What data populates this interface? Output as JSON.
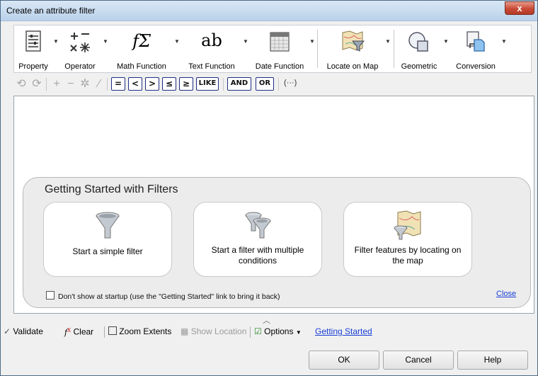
{
  "window": {
    "title": "Create an attribute filter",
    "close_glyph": "x"
  },
  "ribbon": {
    "items": [
      {
        "label": "Property",
        "icon": "property-list-icon"
      },
      {
        "label": "Operator",
        "icon": "operator-icon"
      },
      {
        "label": "Math Function",
        "icon": "math-function-icon",
        "glyph": "fΣ"
      },
      {
        "label": "Text Function",
        "icon": "text-function-icon",
        "glyph": "ab"
      },
      {
        "label": "Date Function",
        "icon": "calendar-icon"
      },
      {
        "label": "Locate on Map",
        "icon": "map-filter-icon"
      },
      {
        "label": "Geometric",
        "icon": "geometric-icon"
      },
      {
        "label": "Conversion",
        "icon": "conversion-icon"
      }
    ]
  },
  "operators": {
    "eq": "=",
    "lt": "<",
    "gt": ">",
    "le": "≤",
    "ge": "≥",
    "like": "LIKE",
    "and": "AND",
    "or": "OR",
    "paren": "(···)"
  },
  "getting_started": {
    "title": "Getting Started with Filters",
    "cards": [
      {
        "text": "Start a simple filter",
        "icon": "funnel-icon"
      },
      {
        "text": "Start a filter with multiple conditions",
        "icon": "multiple-funnels-icon"
      },
      {
        "text": "Filter features by locating on the map",
        "icon": "map-funnel-icon"
      }
    ],
    "checkbox_label": "Don't show at startup (use the \"Getting Started\" link to bring it back)",
    "close_link": "Close"
  },
  "statusbar": {
    "validate": "Validate",
    "clear": "Clear",
    "zoom_extents": "Zoom Extents",
    "show_location": "Show Location",
    "options": "Options",
    "getting_started": "Getting Started"
  },
  "buttons": {
    "ok": "OK",
    "cancel": "Cancel",
    "help": "Help"
  },
  "colors": {
    "accent_link": "#1a3fd6",
    "operator_border": "#1f2e86",
    "close_red": "#c94a36"
  }
}
